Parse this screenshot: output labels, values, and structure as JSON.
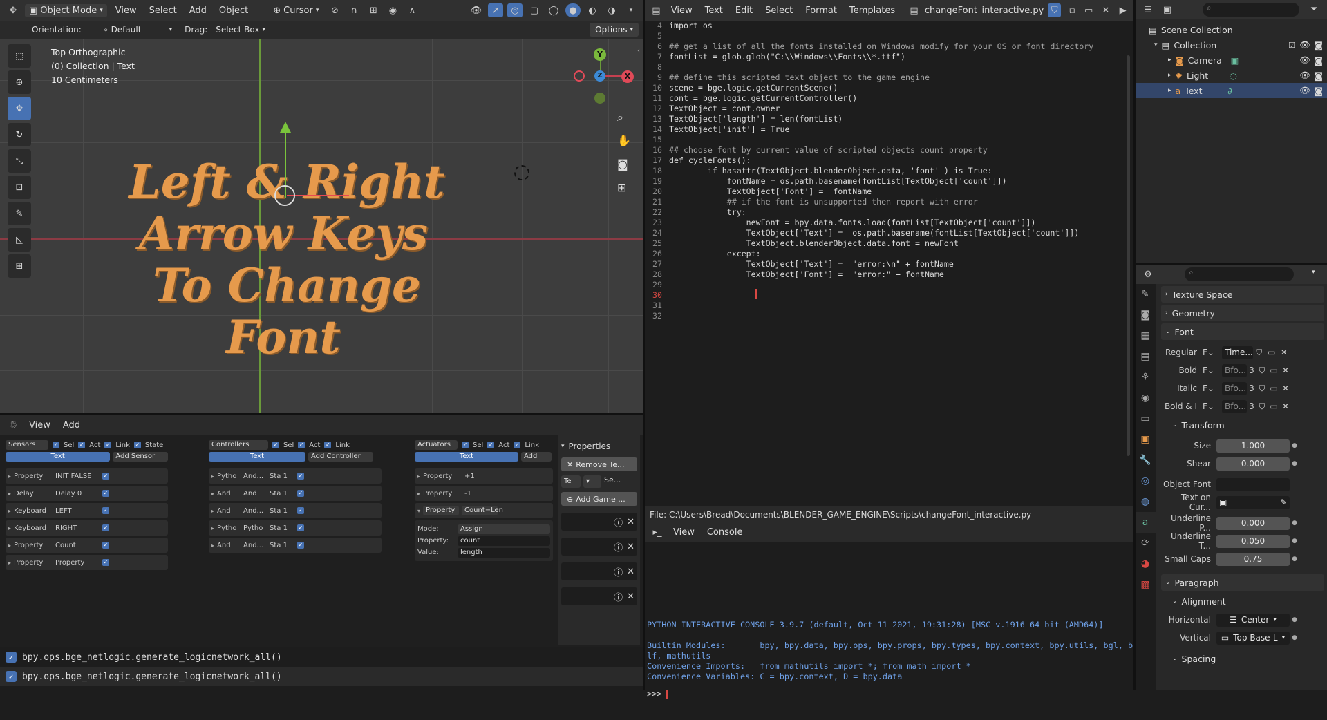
{
  "viewport": {
    "mode": "Object Mode",
    "menu": [
      "View",
      "Select",
      "Add",
      "Object"
    ],
    "transform": "Cursor",
    "orientation_label": "Orientation:",
    "orientation_value": "Default",
    "drag_label": "Drag:",
    "drag_value": "Select Box",
    "options": "Options",
    "overlay_lines": [
      "Top Orthographic",
      "(0) Collection | Text",
      "10 Centimeters"
    ],
    "scene_text": [
      "Left & Right",
      "Arrow Keys",
      "To Change",
      "Font"
    ],
    "gizmo": {
      "y": "Y",
      "x": "X",
      "z": "Z"
    }
  },
  "logic": {
    "menu": [
      "View",
      "Add"
    ],
    "sensors": {
      "title": "Sensors",
      "sel": "Sel",
      "act": "Act",
      "link": "Link",
      "state": "State",
      "object": "Text",
      "add": "Add Sensor",
      "rows": [
        {
          "type": "Property",
          "value": "INIT FALSE"
        },
        {
          "type": "Delay",
          "value": "Delay 0"
        },
        {
          "type": "Keyboard",
          "value": "LEFT"
        },
        {
          "type": "Keyboard",
          "value": "RIGHT"
        },
        {
          "type": "Property",
          "value": "Count"
        },
        {
          "type": "Property",
          "value": "Property"
        }
      ]
    },
    "controllers": {
      "title": "Controllers",
      "sel": "Sel",
      "act": "Act",
      "link": "Link",
      "object": "Text",
      "add": "Add Controller",
      "rows": [
        {
          "type": "Pytho",
          "value": "And...",
          "state": "Sta 1"
        },
        {
          "type": "And",
          "value": "And",
          "state": "Sta 1"
        },
        {
          "type": "And",
          "value": "And...",
          "state": "Sta 1"
        },
        {
          "type": "Pytho",
          "value": "Pytho",
          "state": "Sta 1"
        },
        {
          "type": "And",
          "value": "And...",
          "state": "Sta 1"
        }
      ]
    },
    "actuators": {
      "title": "Actuators",
      "sel": "Sel",
      "act": "Act",
      "link": "Link",
      "object": "Text",
      "add": "Add Actua",
      "rows": [
        {
          "type": "Property",
          "value": "+1"
        },
        {
          "type": "Property",
          "value": "-1"
        },
        {
          "type": "Property",
          "value": "Count=Len"
        }
      ],
      "expanded": {
        "mode_label": "Mode:",
        "mode": "Assign",
        "property_label": "Property:",
        "property": "count",
        "value_label": "Value:",
        "value": "length"
      }
    },
    "panel": {
      "title": "Properties",
      "remove": "Remove Te...",
      "te": "Te",
      "se": "Se...",
      "add_game": "Add Game ..."
    }
  },
  "texteditor": {
    "menu": [
      "View",
      "Text",
      "Edit",
      "Select",
      "Format",
      "Templates"
    ],
    "filename": "changeFont_interactive.py",
    "file_path": "File: C:\\Users\\Bread\\Documents\\BLENDER_GAME_ENGINE\\Scripts\\changeFont_interactive.py",
    "lines": [
      {
        "n": "4",
        "t": "import os"
      },
      {
        "n": "5",
        "t": ""
      },
      {
        "n": "6",
        "t": "## get a list of all the fonts installed on Windows modify for your OS or font directory"
      },
      {
        "n": "7",
        "t": "fontList = glob.glob(\"C:\\\\Windows\\\\Fonts\\\\*.ttf\")"
      },
      {
        "n": "8",
        "t": ""
      },
      {
        "n": "9",
        "t": "## define this scripted text object to the game engine"
      },
      {
        "n": "10",
        "t": "scene = bge.logic.getCurrentScene()"
      },
      {
        "n": "11",
        "t": "cont = bge.logic.getCurrentController()"
      },
      {
        "n": "12",
        "t": "TextObject = cont.owner"
      },
      {
        "n": "13",
        "t": "TextObject['length'] = len(fontList)"
      },
      {
        "n": "14",
        "t": "TextObject['init'] = True"
      },
      {
        "n": "15",
        "t": ""
      },
      {
        "n": "16",
        "t": "## choose font by current value of scripted objects count property"
      },
      {
        "n": "17",
        "t": "def cycleFonts():"
      },
      {
        "n": "18",
        "t": "        if hasattr(TextObject.blenderObject.data, 'font' ) is True:"
      },
      {
        "n": "19",
        "t": "            fontName = os.path.basename(fontList[TextObject['count']])"
      },
      {
        "n": "20",
        "t": "            TextObject['Font'] =  fontName"
      },
      {
        "n": "21",
        "t": "            ## if the font is unsupported then report with error"
      },
      {
        "n": "22",
        "t": "            try:"
      },
      {
        "n": "23",
        "t": "                newFont = bpy.data.fonts.load(fontList[TextObject['count']])"
      },
      {
        "n": "24",
        "t": "                TextObject['Text'] =  os.path.basename(fontList[TextObject['count']])"
      },
      {
        "n": "25",
        "t": "                TextObject.blenderObject.data.font = newFont"
      },
      {
        "n": "26",
        "t": "            except:"
      },
      {
        "n": "27",
        "t": "                TextObject['Text'] =  \"error:\\n\" + fontName"
      },
      {
        "n": "28",
        "t": "                TextObject['Font'] =  \"error:\" + fontName"
      },
      {
        "n": "29",
        "t": ""
      },
      {
        "n": "30",
        "t": ""
      },
      {
        "n": "31",
        "t": ""
      },
      {
        "n": "32",
        "t": ""
      }
    ]
  },
  "console": {
    "menu": [
      "View",
      "Console"
    ],
    "lines": [
      "PYTHON INTERACTIVE CONSOLE 3.9.7 (default, Oct 11 2021, 19:31:28) [MSC v.1916 64 bit (AMD64)]",
      "",
      "Builtin Modules:       bpy, bpy.data, bpy.ops, bpy.props, bpy.types, bpy.context, bpy.utils, bgl, b",
      "lf, mathutils",
      "Convenience Imports:   from mathutils import *; from math import *",
      "Convenience Variables: C = bpy.context, D = bpy.data"
    ],
    "prompt": ">>> "
  },
  "outliner": {
    "rows": [
      {
        "label": "Scene Collection",
        "indent": 0
      },
      {
        "label": "Collection",
        "indent": 1
      },
      {
        "label": "Camera",
        "indent": 2
      },
      {
        "label": "Light",
        "indent": 2
      },
      {
        "label": "Text",
        "indent": 2
      }
    ]
  },
  "properties": {
    "sections": {
      "texture_space": "Texture Space",
      "geometry": "Geometry",
      "font": "Font",
      "transform": "Transform",
      "paragraph": "Paragraph",
      "alignment": "Alignment",
      "spacing": "Spacing"
    },
    "fonts": [
      {
        "label": "Regular",
        "value": "Time...",
        "num": ""
      },
      {
        "label": "Bold",
        "value": "Bfo...",
        "num": "3"
      },
      {
        "label": "Italic",
        "value": "Bfo...",
        "num": "3"
      },
      {
        "label": "Bold & I",
        "value": "Bfo...",
        "num": "3"
      }
    ],
    "size_label": "Size",
    "size": "1.000",
    "shear_label": "Shear",
    "shear": "0.000",
    "object_font_label": "Object Font",
    "text_on_curve_label": "Text on Cur...",
    "underline_pos_label": "Underline P...",
    "underline_pos": "0.000",
    "underline_thick_label": "Underline T...",
    "underline_thick": "0.050",
    "small_caps_label": "Small Caps",
    "small_caps": "0.75",
    "horizontal_label": "Horizontal",
    "horizontal": "Center",
    "vertical_label": "Vertical",
    "vertical": "Top Base-L"
  },
  "status": {
    "lines": [
      "bpy.ops.bge_netlogic.generate_logicnetwork_all()",
      "bpy.ops.bge_netlogic.generate_logicnetwork_all()"
    ]
  },
  "colors": {
    "accent": "#4772b3",
    "text_orange": "#e69a4c"
  }
}
